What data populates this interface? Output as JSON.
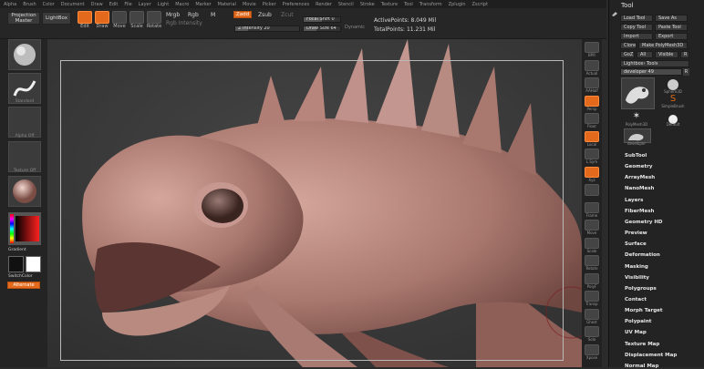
{
  "menu": [
    "Alpha",
    "Brush",
    "Color",
    "Document",
    "Draw",
    "Edit",
    "File",
    "Layer",
    "Light",
    "Macro",
    "Marker",
    "Material",
    "Movie",
    "Picker",
    "Preferences",
    "Render",
    "Stencil",
    "Stroke",
    "Texture",
    "Tool",
    "Transform",
    "Zplugin",
    "Zscript"
  ],
  "topbar": {
    "projection_master": "Projection Master",
    "lightbox": "LightBox",
    "tools": [
      {
        "label": "Edit",
        "active": true
      },
      {
        "label": "Draw",
        "active": true
      },
      {
        "label": "Move",
        "active": false
      },
      {
        "label": "Scale",
        "active": false
      },
      {
        "label": "Rotate",
        "active": false
      }
    ],
    "mrgb": "Mrgb",
    "rgb": "Rgb",
    "m": "M",
    "rgb_intensity": "Rgb Intensity",
    "zadd": "Zadd",
    "zsub": "Zsub",
    "zcut": "Zcut",
    "z_intensity": "Z Intensity 20",
    "focal_shift": "Focal Shift 0",
    "draw_size": "Draw Size 64",
    "dynamic": "Dynamic",
    "active_points": "ActivePoints: 8.049 Mil",
    "total_points": "TotalPoints: 11.231 Mil"
  },
  "left_shelf": {
    "thumb_labels": [
      "",
      "Standard",
      "Alpha Off",
      "Texture Off",
      "MatCap"
    ],
    "gradient": "Gradient",
    "switch_color": "SwitchColor",
    "alternate": "Alternate"
  },
  "right_shelf": [
    {
      "label": "BPR",
      "active": false
    },
    {
      "label": "Actual",
      "active": false
    },
    {
      "label": "AAHalf",
      "active": false
    },
    {
      "label": "Persp",
      "active": true
    },
    {
      "label": "Floor",
      "active": false
    },
    {
      "label": "Local",
      "active": true
    },
    {
      "label": "L.Sym",
      "active": false
    },
    {
      "label": "Xyz",
      "active": true
    },
    {
      "label": "",
      "active": false
    },
    {
      "label": "Frame",
      "active": false
    },
    {
      "label": "Move",
      "active": false
    },
    {
      "label": "Scale",
      "active": false
    },
    {
      "label": "Rotate",
      "active": false
    },
    {
      "label": "PolyF",
      "active": false
    },
    {
      "label": "Transp",
      "active": false
    },
    {
      "label": "Ghost",
      "active": false
    },
    {
      "label": "Solo",
      "active": false
    },
    {
      "label": "Xpose",
      "active": false
    }
  ],
  "tool_panel": {
    "title": "Tool",
    "buttons": {
      "load_tool": "Load Tool",
      "save_as": "Save As",
      "copy_tool": "Copy Tool",
      "paste_tool": "Paste Tool",
      "import": "Import",
      "export": "Export",
      "clone": "Clone",
      "make_polymesh": "Make PolyMesh3D",
      "goz": "GoZ",
      "all": "All",
      "visible": "Visible",
      "r": "R",
      "lightbox_tools": "Lightbox› Tools"
    },
    "current_tool": "developer 49",
    "tool_thumbs": [
      "Sphere3D",
      "SimpleBrush",
      "PolyMesh3D",
      "Default",
      "developer"
    ],
    "sections": [
      "SubTool",
      "Geometry",
      "ArrayMesh",
      "NanoMesh",
      "Layers",
      "FiberMesh",
      "Geometry HD",
      "Preview",
      "Surface",
      "Deformation",
      "Masking",
      "Visibility",
      "Polygroups",
      "Contact",
      "Morph Target",
      "Polypaint",
      "UV Map",
      "Texture Map",
      "Displacement Map",
      "Normal Map"
    ]
  },
  "colors": {
    "accent": "#e36a1c",
    "model": "#b98a80",
    "background": "#3a3a3a"
  }
}
